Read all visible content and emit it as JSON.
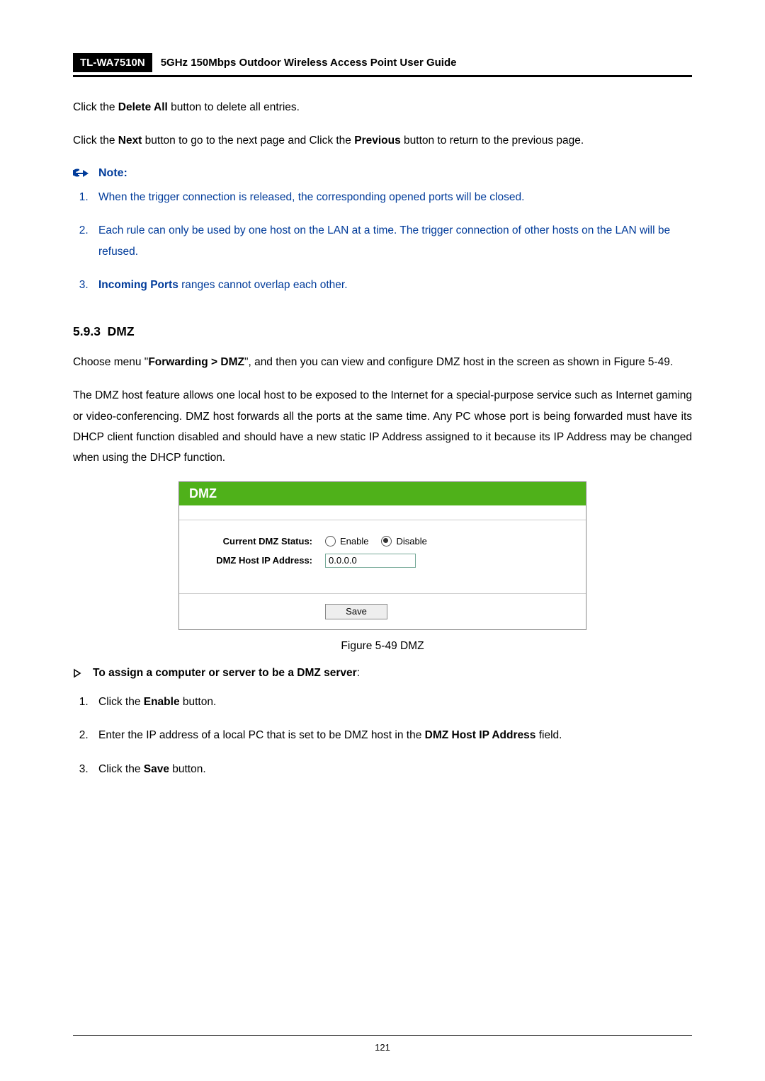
{
  "header": {
    "model": "TL-WA7510N",
    "title": "5GHz 150Mbps Outdoor Wireless Access Point User Guide"
  },
  "para1": {
    "t1": "Click the ",
    "b1": "Delete All",
    "t2": " button to delete all entries."
  },
  "para2": {
    "t1": "Click the ",
    "b1": "Next",
    "t2": " button to go to the next page and Click the ",
    "b2": "Previous",
    "t3": " button to return to the previous page."
  },
  "note": {
    "heading": "Note:",
    "i1": "When the trigger connection is released, the corresponding opened ports will be closed.",
    "i2": "Each rule can only be used by one host on the LAN at a time. The trigger connection of other hosts on the LAN will be refused.",
    "i3a": "Incoming Ports",
    "i3b": " ranges cannot overlap each other."
  },
  "section": {
    "num": "5.9.3",
    "title": "DMZ"
  },
  "para3": {
    "t1": "Choose menu \"",
    "b1": "Forwarding > DMZ",
    "t2": "\", and then you can view and configure DMZ host in the screen as shown in Figure 5-49."
  },
  "para4": "The DMZ host feature allows one local host to be exposed to the Internet for a special-purpose service such as Internet gaming or video-conferencing. DMZ host forwards all the ports at the same time. Any PC whose port is being forwarded must have its DHCP client function disabled and should have a new static IP Address assigned to it because its IP Address may be changed when using the DHCP function.",
  "dmz": {
    "title": "DMZ",
    "lbl_status": "Current DMZ Status:",
    "opt_enable": "Enable",
    "opt_disable": "Disable",
    "lbl_ip": "DMZ Host IP Address:",
    "ip_value": "0.0.0.0",
    "save": "Save"
  },
  "fig_caption": "Figure 5-49 DMZ",
  "assign": {
    "heading": "To assign a computer or server to be a DMZ server",
    "colon": ":",
    "s1a": "Click the ",
    "s1b": "Enable",
    "s1c": " button.",
    "s2a": "Enter the IP address of a local PC that is set to be DMZ host in the ",
    "s2b": "DMZ Host IP Address",
    "s2c": " field.",
    "s3a": "Click the ",
    "s3b": "Save",
    "s3c": " button."
  },
  "page_number": "121"
}
